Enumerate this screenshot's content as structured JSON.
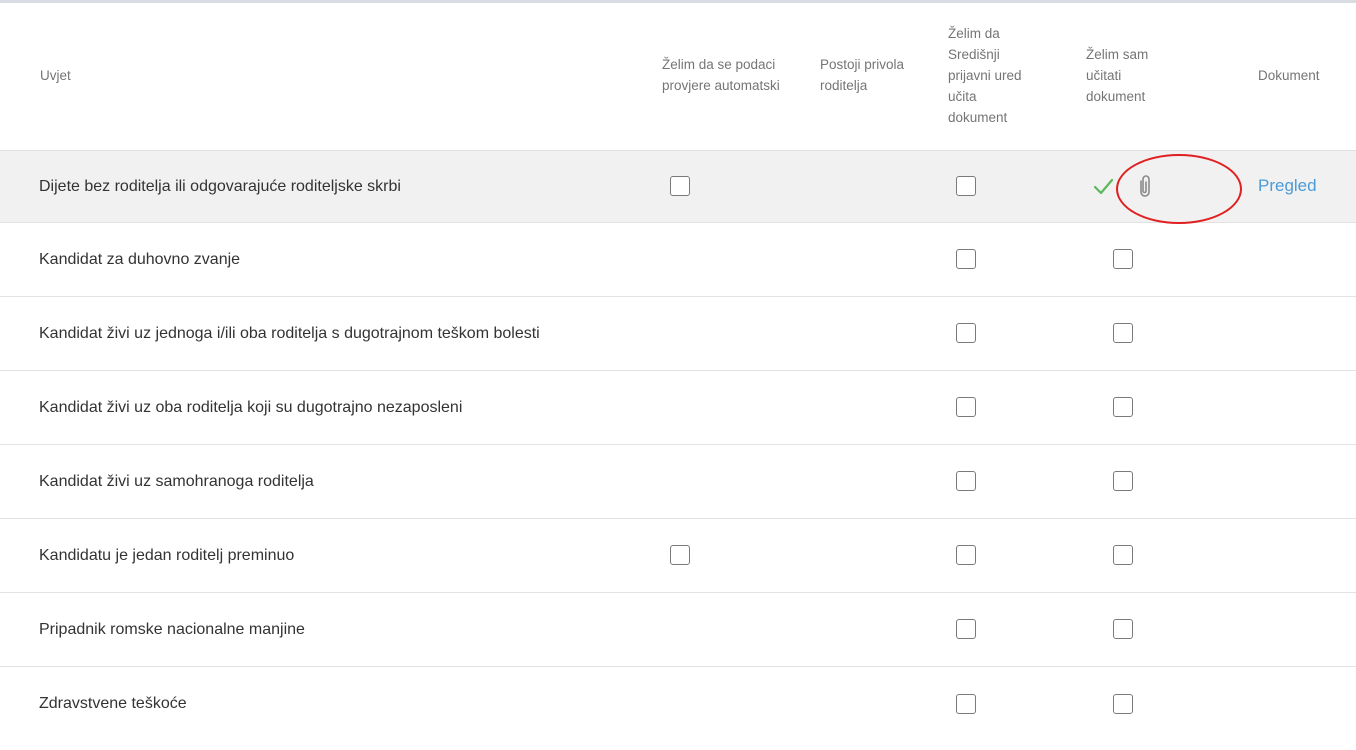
{
  "table": {
    "headers": {
      "condition": "Uvjet",
      "auto_check": "Želim da se podaci provjere automatski",
      "parent_consent": "Postoji privola roditelja",
      "office_upload": "Želim da Središnji prijavni ured učita dokument",
      "self_upload": "Želim sam učitati dokument",
      "document": "Dokument"
    },
    "rows": [
      {
        "label": "Dijete bez roditelja ili odgovarajuće roditeljske skrbi",
        "auto_check": true,
        "office_upload": true,
        "self_upload": "uploaded",
        "document_link": "Pregled"
      },
      {
        "label": "Kandidat za duhovno zvanje",
        "auto_check": false,
        "office_upload": true,
        "self_upload": "checkbox"
      },
      {
        "label": "Kandidat živi uz jednoga i/ili oba roditelja s dugotrajnom teškom bolesti",
        "auto_check": false,
        "office_upload": true,
        "self_upload": "checkbox"
      },
      {
        "label": "Kandidat živi uz oba roditelja koji su dugotrajno nezaposleni",
        "auto_check": false,
        "office_upload": true,
        "self_upload": "checkbox"
      },
      {
        "label": "Kandidat živi uz samohranoga roditelja",
        "auto_check": false,
        "office_upload": true,
        "self_upload": "checkbox"
      },
      {
        "label": "Kandidatu je jedan roditelj preminuo",
        "auto_check": true,
        "office_upload": true,
        "self_upload": "checkbox"
      },
      {
        "label": "Pripadnik romske nacionalne manjine",
        "auto_check": false,
        "office_upload": true,
        "self_upload": "checkbox"
      },
      {
        "label": "Zdravstvene teškoće",
        "auto_check": false,
        "office_upload": true,
        "self_upload": "checkbox"
      }
    ]
  },
  "icons": {
    "uploaded": "check-icon",
    "attachment": "paperclip-icon"
  },
  "colors": {
    "check": "#5cb85c",
    "link": "#4a9bd8",
    "annotation": "#e02020",
    "highlight_row": "#f1f1f1"
  }
}
